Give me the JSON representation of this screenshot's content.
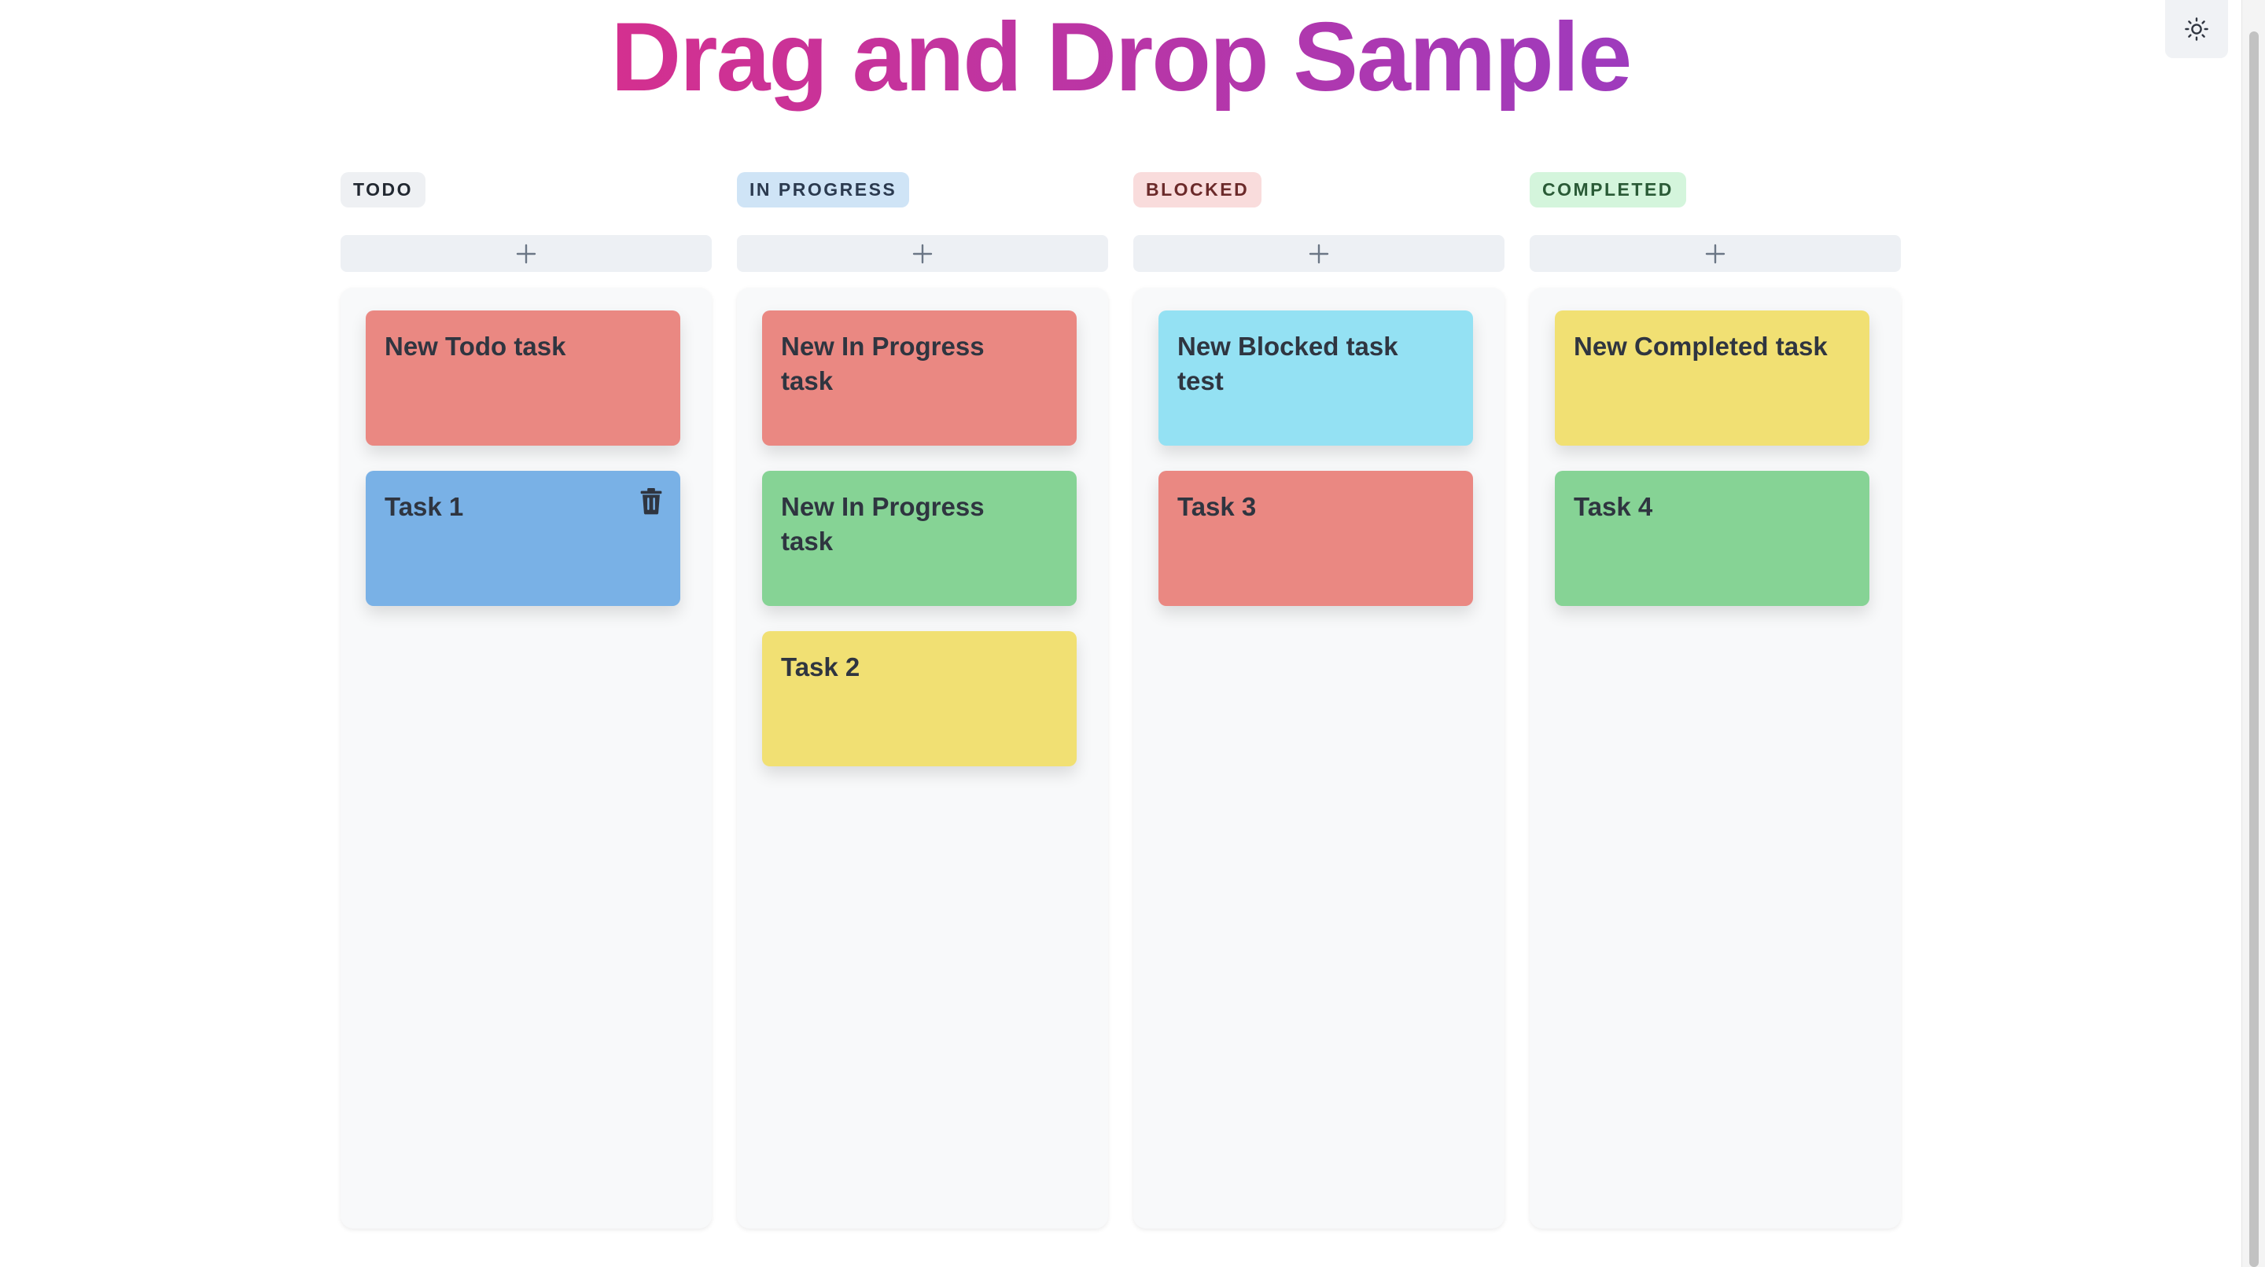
{
  "app": {
    "title": "Drag and Drop Sample",
    "theme_toggle_icon": "sun-icon"
  },
  "columns": [
    {
      "label": "TODO",
      "badge_bg": "#eef0f3",
      "badge_fg": "#222831",
      "add_icon": "plus-icon",
      "cards": [
        {
          "text": "New Todo task",
          "color": "#ea8882"
        },
        {
          "text": "Task 1",
          "color": "#79b1e6",
          "delete_icon": "trash-icon"
        }
      ]
    },
    {
      "label": "IN PROGRESS",
      "badge_bg": "#cfe4f6",
      "badge_fg": "#2b3a4f",
      "add_icon": "plus-icon",
      "cards": [
        {
          "text": "New In Progress task",
          "color": "#ea8882"
        },
        {
          "text": "New In Progress task",
          "color": "#86d395"
        },
        {
          "text": "Task 2",
          "color": "#f1e073"
        }
      ]
    },
    {
      "label": "BLOCKED",
      "badge_bg": "#f9dcdc",
      "badge_fg": "#6b2a2a",
      "add_icon": "plus-icon",
      "cards": [
        {
          "text": "New Blocked task test",
          "color": "#94e1f3"
        },
        {
          "text": "Task 3",
          "color": "#ea8882"
        }
      ]
    },
    {
      "label": "COMPLETED",
      "badge_bg": "#d4f5dc",
      "badge_fg": "#2a5a36",
      "add_icon": "plus-icon",
      "cards": [
        {
          "text": "New Completed task",
          "color": "#f1e073"
        },
        {
          "text": "Task 4",
          "color": "#86d395"
        }
      ]
    }
  ]
}
